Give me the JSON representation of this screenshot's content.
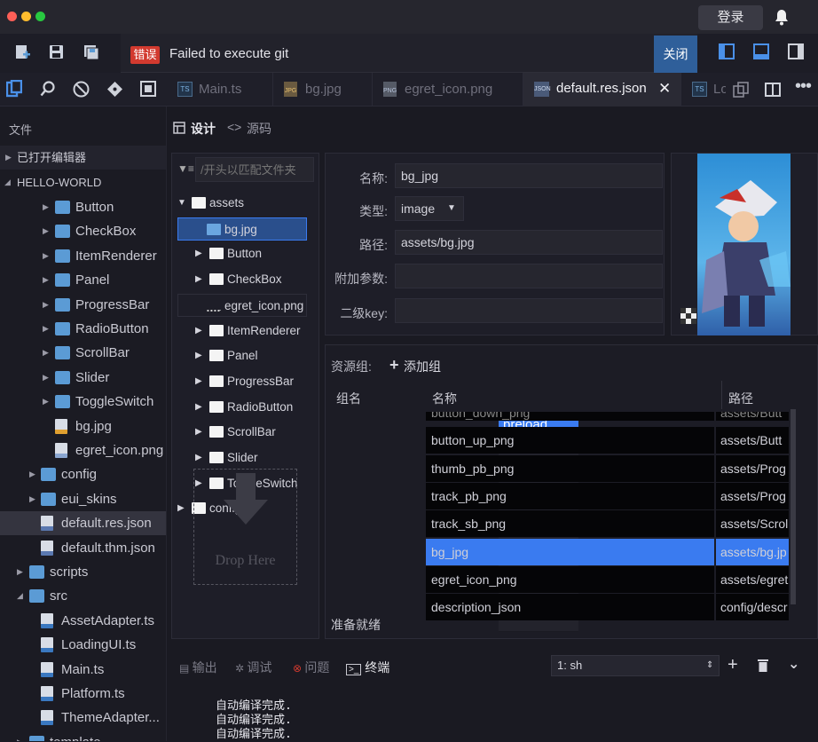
{
  "titlebar": {
    "login": "登录"
  },
  "toast": {
    "badge": "错误",
    "message": "Failed to execute git",
    "close": "关闭"
  },
  "tabs": [
    {
      "label": "Main.ts",
      "icon": "TS"
    },
    {
      "label": "bg.jpg",
      "icon": "JPG"
    },
    {
      "label": "egret_icon.png",
      "icon": "PNG"
    },
    {
      "label": "default.res.json",
      "icon": "JSON",
      "active": true
    },
    {
      "label": "Lo",
      "icon": "TS"
    }
  ],
  "sidebar": {
    "header": "文件",
    "open_editors": "已打开编辑器",
    "project": "HELLO-WORLD",
    "items": [
      {
        "label": "Button",
        "type": "folder"
      },
      {
        "label": "CheckBox",
        "type": "folder"
      },
      {
        "label": "ItemRenderer",
        "type": "folder"
      },
      {
        "label": "Panel",
        "type": "folder"
      },
      {
        "label": "ProgressBar",
        "type": "folder"
      },
      {
        "label": "RadioButton",
        "type": "folder"
      },
      {
        "label": "ScrollBar",
        "type": "folder"
      },
      {
        "label": "Slider",
        "type": "folder"
      },
      {
        "label": "ToggleSwitch",
        "type": "folder"
      },
      {
        "label": "bg.jpg",
        "type": "jpg"
      },
      {
        "label": "egret_icon.png",
        "type": "png"
      },
      {
        "label": "config",
        "type": "folder"
      },
      {
        "label": "eui_skins",
        "type": "folder"
      },
      {
        "label": "default.res.json",
        "type": "json"
      },
      {
        "label": "default.thm.json",
        "type": "json"
      },
      {
        "label": "scripts",
        "type": "folder"
      },
      {
        "label": "src",
        "type": "folder"
      },
      {
        "label": "AssetAdapter.ts",
        "type": "ts"
      },
      {
        "label": "LoadingUI.ts",
        "type": "ts"
      },
      {
        "label": "Main.ts",
        "type": "ts"
      },
      {
        "label": "Platform.ts",
        "type": "ts"
      },
      {
        "label": "ThemeAdapter...",
        "type": "ts"
      },
      {
        "label": "template",
        "type": "folder"
      }
    ]
  },
  "editor": {
    "mode_design": "设计",
    "mode_source": "源码",
    "filter_placeholder": "/开头以匹配文件夹",
    "tree": [
      {
        "label": "assets"
      },
      {
        "label": "bg.jpg"
      },
      {
        "label": "Button"
      },
      {
        "label": "CheckBox"
      },
      {
        "label": "egret_icon.png"
      },
      {
        "label": "ItemRenderer"
      },
      {
        "label": "Panel"
      },
      {
        "label": "ProgressBar"
      },
      {
        "label": "RadioButton"
      },
      {
        "label": "ScrollBar"
      },
      {
        "label": "Slider"
      },
      {
        "label": "ToggleSwitch"
      },
      {
        "label": "config"
      }
    ],
    "drop_here": "Drop Here",
    "props": {
      "name_label": "名称:",
      "name_value": "bg_jpg",
      "type_label": "类型:",
      "type_value": "image",
      "path_label": "路径:",
      "path_value": "assets/bg.jpg",
      "extra_label": "附加参数:",
      "extra_value": "",
      "sub_label": "二级key:",
      "sub_value": ""
    },
    "groups": {
      "title": "资源组:",
      "add": "添加组",
      "col_group": "组名",
      "col_name": "名称",
      "col_path": "路径",
      "group_items": [
        "preload"
      ],
      "rows": [
        {
          "name": "button_down_png",
          "path": "assets/Butt"
        },
        {
          "name": "button_up_png",
          "path": "assets/Butt"
        },
        {
          "name": "thumb_pb_png",
          "path": "assets/Prog"
        },
        {
          "name": "track_pb_png",
          "path": "assets/Prog"
        },
        {
          "name": "track_sb_png",
          "path": "assets/Scrol"
        },
        {
          "name": "bg_jpg",
          "path": "assets/bg.jp",
          "selected": true
        },
        {
          "name": "egret_icon_png",
          "path": "assets/egret"
        },
        {
          "name": "description_json",
          "path": "config/descr"
        }
      ],
      "status": "准备就绪"
    }
  },
  "terminal": {
    "tab_output": "输出",
    "tab_debug": "调试",
    "tab_problems": "问题",
    "tab_terminal": "终端",
    "select": "1: sh",
    "lines": [
      "自动编译完成.",
      "自动编译完成.",
      "自动编译完成."
    ]
  },
  "colors": {
    "accent": "#3a7bf0",
    "error": "#d23a2f",
    "folder": "#5b9bd5"
  }
}
